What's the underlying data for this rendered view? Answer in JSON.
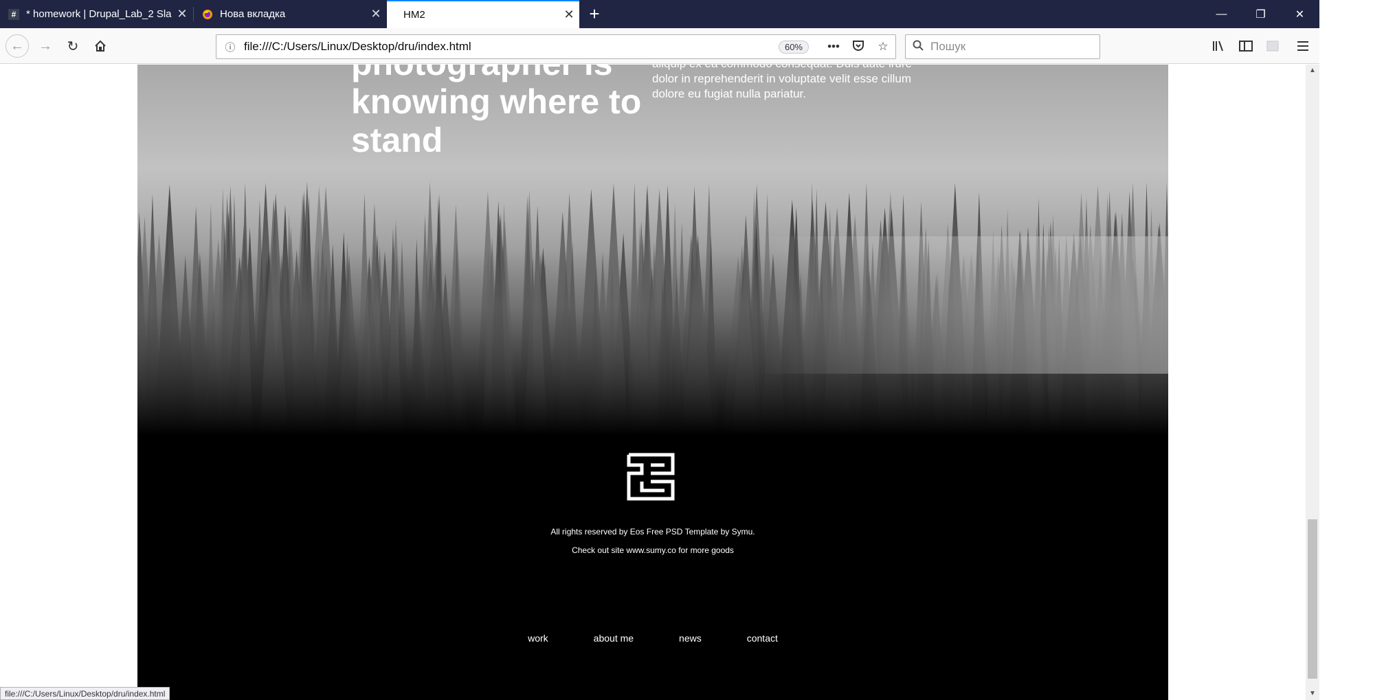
{
  "browser": {
    "tabs": [
      {
        "title": "* homework | Drupal_Lab_2 Sla",
        "favicon": "#",
        "active": false
      },
      {
        "title": "Нова вкладка",
        "favicon": "firefox-icon",
        "active": false
      },
      {
        "title": "HM2",
        "favicon": "",
        "active": true
      }
    ],
    "new_tab_label": "+",
    "url": "file:///C:/Users/Linux/Desktop/dru/index.html",
    "zoom": "60%",
    "search_placeholder": "Пошук",
    "status_url": "file:///C:/Users/Linux/Desktop/dru/index.html"
  },
  "page": {
    "headline_lines": [
      "photographer is",
      "knowing where to",
      "stand"
    ],
    "paragraph_lines": [
      "aliquip ex ea commodo consequat. Duis aute irure",
      "dolor in reprehenderit in voluptate velit esse cillum",
      "dolore eu fugiat nulla pariatur."
    ],
    "footer": {
      "copyright": "All rights reserved by Eos Free PSD Template by Symu.",
      "checkout": "Check out site www.sumy.co for more goods",
      "nav": [
        "work",
        "about me",
        "news",
        "contact"
      ]
    }
  },
  "colors": {
    "tabbar": "#1f2543",
    "active_tab_accent": "#0a84ff",
    "page_background": "#000000",
    "text": "#ffffff"
  }
}
